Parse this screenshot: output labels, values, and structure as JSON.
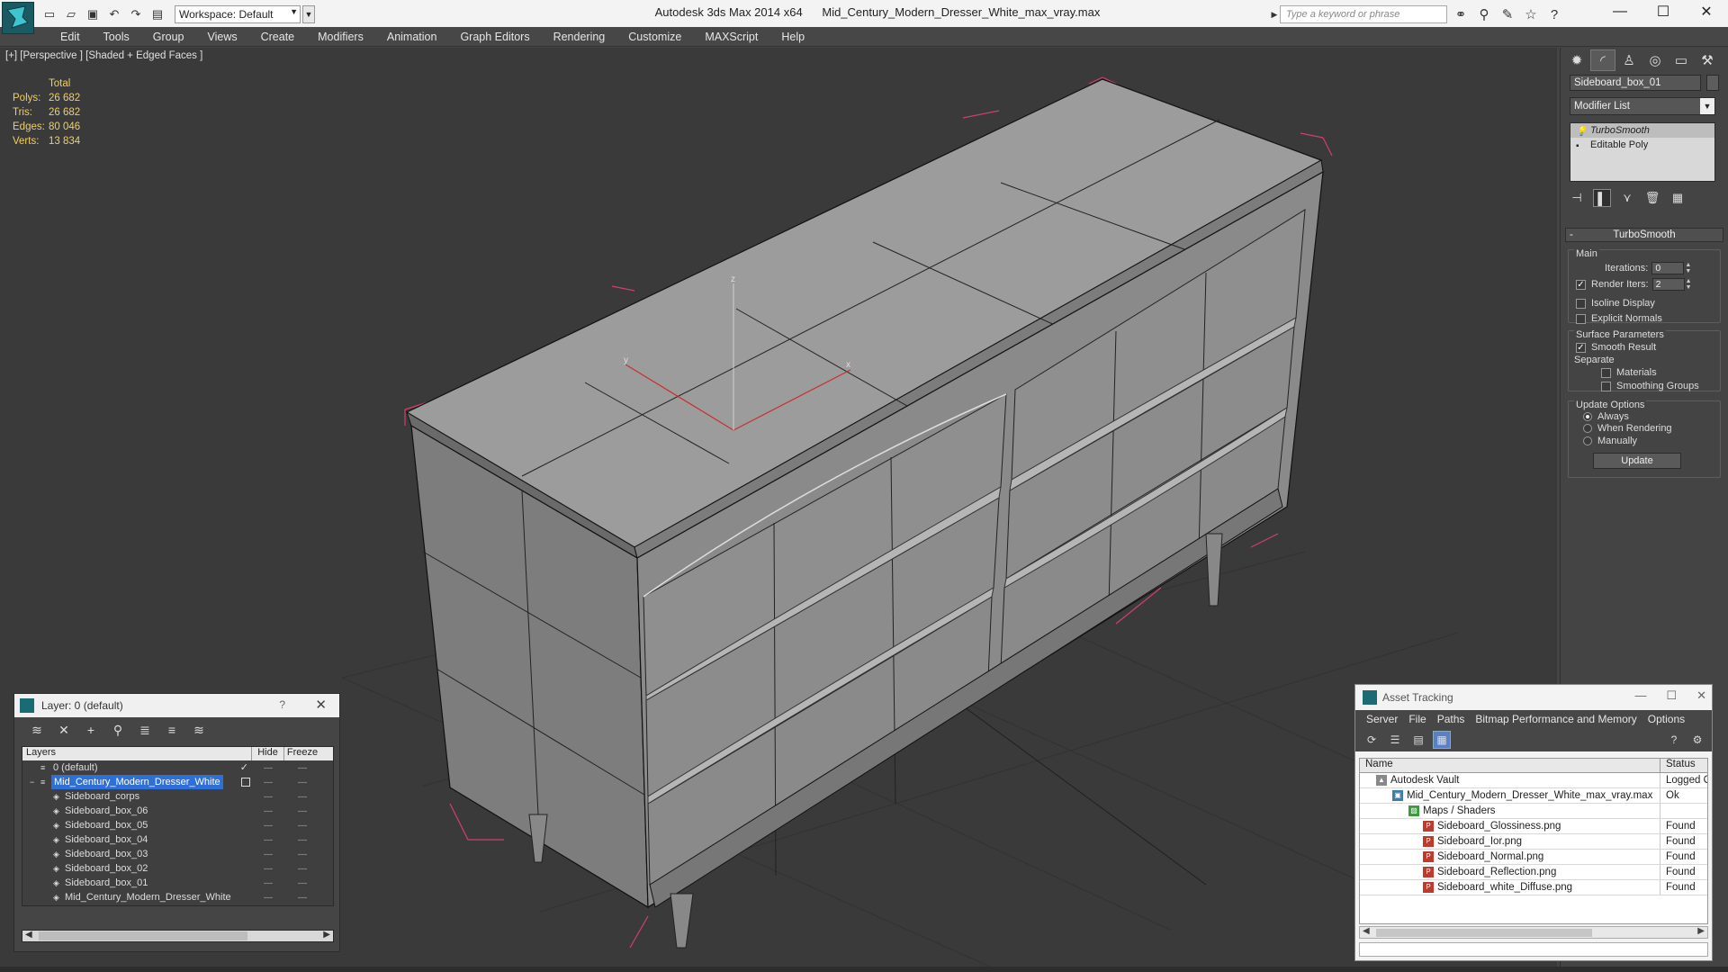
{
  "titlebar": {
    "app_title": "Autodesk 3ds Max 2014 x64",
    "file_title": "Mid_Century_Modern_Dresser_White_max_vray.max",
    "workspace_label": "Workspace: Default",
    "search_placeholder": "Type a keyword or phrase"
  },
  "menu": {
    "items": [
      "Edit",
      "Tools",
      "Group",
      "Views",
      "Create",
      "Modifiers",
      "Animation",
      "Graph Editors",
      "Rendering",
      "Customize",
      "MAXScript",
      "Help"
    ]
  },
  "viewport": {
    "label": "[+] [Perspective ] [Shaded + Edged Faces ]",
    "stats": {
      "header": "Total",
      "rows": [
        {
          "key": "Polys:",
          "value": "26 682"
        },
        {
          "key": "Tris:",
          "value": "26 682"
        },
        {
          "key": "Edges:",
          "value": "80 046"
        },
        {
          "key": "Verts:",
          "value": "13 834"
        }
      ]
    },
    "axis": {
      "z": "z",
      "x": "x",
      "y": "y"
    },
    "colors": {
      "background": "#3a3a3a",
      "selection_bracket": "#d0406a",
      "grid": "#303030",
      "axis": "#c83030"
    }
  },
  "command_panel": {
    "object_name": "Sideboard_box_01",
    "modifier_list": "Modifier List",
    "stack": [
      "TurboSmooth",
      "Editable Poly"
    ],
    "rollout": {
      "title": "TurboSmooth",
      "main_group": "Main",
      "iterations_label": "Iterations:",
      "iterations_value": "0",
      "render_iters_label": "Render Iters:",
      "render_iters_value": "2",
      "render_iters_checked": true,
      "isoline_label": "Isoline Display",
      "explicit_normals_label": "Explicit Normals",
      "surface_group": "Surface Parameters",
      "smooth_result_label": "Smooth Result",
      "separate_label": "Separate",
      "materials_label": "Materials",
      "smoothing_groups_label": "Smoothing Groups",
      "update_group": "Update Options",
      "always_label": "Always",
      "when_rendering_label": "When Rendering",
      "manually_label": "Manually",
      "update_button": "Update"
    }
  },
  "layer_panel": {
    "title": "Layer: 0 (default)",
    "help": "?",
    "columns": {
      "layers": "Layers",
      "hide": "Hide",
      "freeze": "Freeze"
    },
    "rows": [
      {
        "name": "0 (default)",
        "indent": 1,
        "icon": "layer-stack-icon",
        "checked": true
      },
      {
        "name": "Mid_Century_Modern_Dresser_White",
        "indent": 1,
        "icon": "layer-stack-icon",
        "selected": true
      },
      {
        "name": "Sideboard_corps",
        "indent": 2,
        "icon": "object-icon"
      },
      {
        "name": "Sideboard_box_06",
        "indent": 2,
        "icon": "object-icon"
      },
      {
        "name": "Sideboard_box_05",
        "indent": 2,
        "icon": "object-icon"
      },
      {
        "name": "Sideboard_box_04",
        "indent": 2,
        "icon": "object-icon"
      },
      {
        "name": "Sideboard_box_03",
        "indent": 2,
        "icon": "object-icon"
      },
      {
        "name": "Sideboard_box_02",
        "indent": 2,
        "icon": "object-icon"
      },
      {
        "name": "Sideboard_box_01",
        "indent": 2,
        "icon": "object-icon"
      },
      {
        "name": "Mid_Century_Modern_Dresser_White",
        "indent": 2,
        "icon": "object-icon"
      }
    ]
  },
  "asset_panel": {
    "title": "Asset Tracking",
    "menu": [
      "Server",
      "File",
      "Paths",
      "Bitmap Performance and Memory",
      "Options"
    ],
    "columns": {
      "name": "Name",
      "status": "Status"
    },
    "rows": [
      {
        "name": "Autodesk Vault",
        "status": "Logged O",
        "indent": 1,
        "icon": "vault-icon",
        "icon_color": "#888888"
      },
      {
        "name": "Mid_Century_Modern_Dresser_White_max_vray.max",
        "status": "Ok",
        "indent": 2,
        "icon": "max-file-icon",
        "icon_color": "#3b7fa8"
      },
      {
        "name": "Maps / Shaders",
        "status": "",
        "indent": 3,
        "icon": "maps-icon",
        "icon_color": "#3c9a3c"
      },
      {
        "name": "Sideboard_Glossiness.png",
        "status": "Found",
        "indent": 4,
        "icon": "png-icon",
        "icon_color": "#c0392b"
      },
      {
        "name": "Sideboard_Ior.png",
        "status": "Found",
        "indent": 4,
        "icon": "png-icon",
        "icon_color": "#c0392b"
      },
      {
        "name": "Sideboard_Normal.png",
        "status": "Found",
        "indent": 4,
        "icon": "png-icon",
        "icon_color": "#c0392b"
      },
      {
        "name": "Sideboard_Reflection.png",
        "status": "Found",
        "indent": 4,
        "icon": "png-icon",
        "icon_color": "#c0392b"
      },
      {
        "name": "Sideboard_white_Diffuse.png",
        "status": "Found",
        "indent": 4,
        "icon": "png-icon",
        "icon_color": "#c0392b"
      }
    ]
  }
}
